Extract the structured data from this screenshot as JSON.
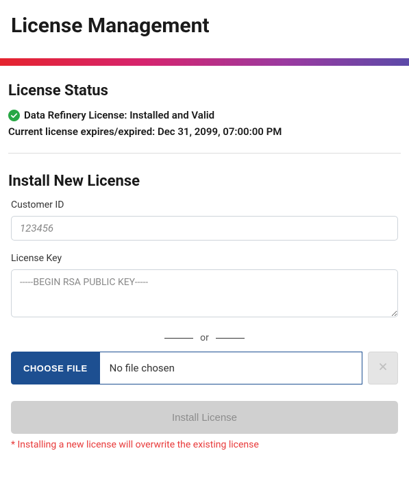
{
  "page": {
    "title": "License Management"
  },
  "status": {
    "heading": "License Status",
    "license_line": "Data Refinery License: Installed and Valid",
    "expiry_line": "Current license expires/expired: Dec 31, 2099, 07:00:00 PM"
  },
  "install": {
    "heading": "Install New License",
    "customer_id_label": "Customer ID",
    "customer_id_placeholder": "123456",
    "license_key_label": "License Key",
    "license_key_placeholder": "-----BEGIN RSA PUBLIC KEY-----",
    "or_text": "or",
    "choose_file_label": "CHOOSE FILE",
    "file_chosen_text": "No file chosen",
    "install_button_label": "Install License",
    "warning_text": "* Installing a new license will overwrite the existing license"
  },
  "icons": {
    "check_color": "#28a745"
  }
}
